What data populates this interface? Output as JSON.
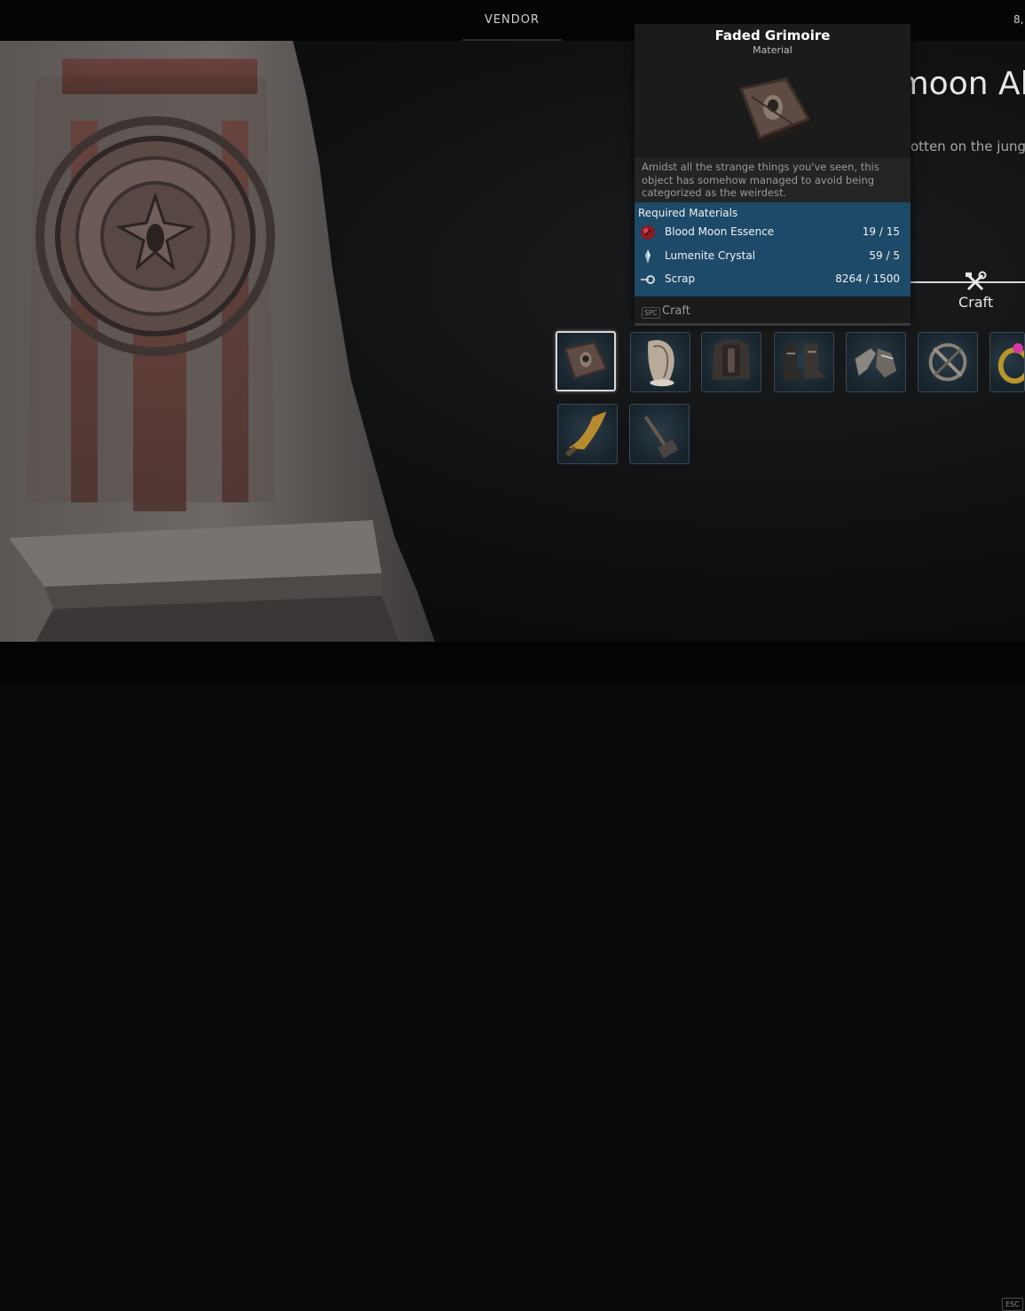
{
  "topbar": {
    "vendor_tab": "VENDOR",
    "currency": "8,"
  },
  "bottombar": {
    "esc_key": "ESC"
  },
  "vendor_title": "Bloodmoon Alt",
  "vendor_description": "otten on the jungle",
  "craft_section": {
    "label": "Craft"
  },
  "tooltip": {
    "name": "Faded Grimoire",
    "type": "Material",
    "description": "Amidst all the strange things you've seen, this object has somehow managed to avoid being categorized as the weirdest.",
    "materials_header": "Required Materials",
    "materials": [
      {
        "name": "Blood Moon Essence",
        "count": "19 / 15",
        "icon": "blood-moon-essence-icon"
      },
      {
        "name": "Lumenite Crystal",
        "count": "59 / 5",
        "icon": "lumenite-crystal-icon"
      },
      {
        "name": "Scrap",
        "count": "8264 / 1500",
        "icon": "scrap-icon"
      }
    ],
    "action_key": "SPC",
    "action_label": "Craft"
  },
  "items": [
    {
      "icon": "faded-grimoire-icon",
      "selected": true
    },
    {
      "icon": "feathered-helm-icon",
      "selected": false
    },
    {
      "icon": "chest-armor-icon",
      "selected": false
    },
    {
      "icon": "boots-icon",
      "selected": false
    },
    {
      "icon": "gauntlets-icon",
      "selected": false
    },
    {
      "icon": "crossed-ring-amulet-icon",
      "selected": false
    },
    {
      "icon": "gem-ring-icon",
      "selected": false
    },
    {
      "icon": "curved-blade-icon",
      "selected": false
    },
    {
      "icon": "hammer-icon",
      "selected": false
    }
  ],
  "colors": {
    "materials_panel": "#1d4a68",
    "tooltip_bg": "#1b1b1b",
    "slot_bg": "#1c2a33"
  }
}
